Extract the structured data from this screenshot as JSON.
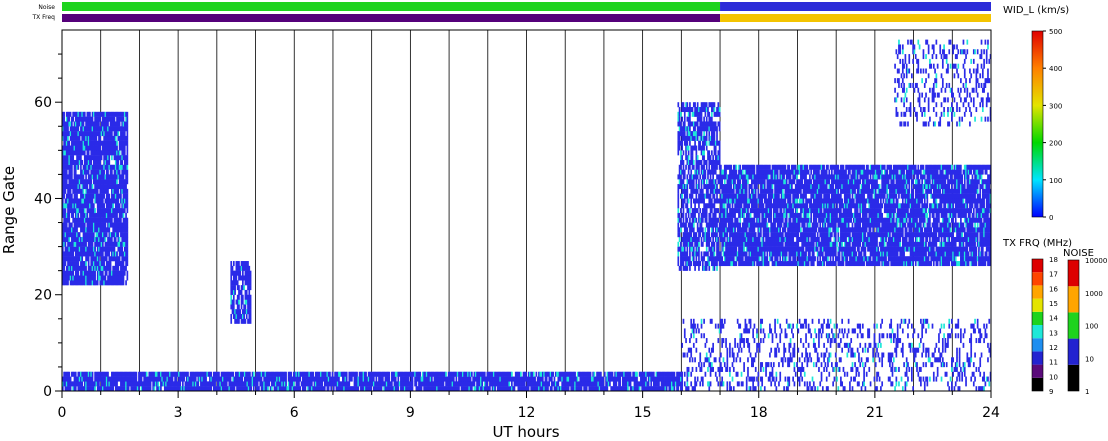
{
  "chart_data": {
    "type": "heatmap",
    "xlabel": "UT hours",
    "ylabel": "Range Gate",
    "xlim": [
      0,
      24
    ],
    "ylim": [
      0,
      75
    ],
    "x_ticks": [
      0,
      3,
      6,
      9,
      12,
      15,
      18,
      21,
      24
    ],
    "y_ticks": [
      0,
      20,
      40,
      60
    ],
    "hour_gridlines": true,
    "strip_labels": {
      "noise": "Noise",
      "freq": "TX Freq"
    },
    "strips": {
      "noise": [
        {
          "t0": 0,
          "t1": 17,
          "color": "#1ed31e"
        },
        {
          "t0": 17,
          "t1": 24,
          "color": "#2b2bd8"
        }
      ],
      "freq": [
        {
          "t0": 0,
          "t1": 17,
          "color": "#55007a"
        },
        {
          "t0": 17,
          "t1": 24,
          "color": "#f4c400"
        }
      ]
    },
    "echo_regions": [
      {
        "t0": 0.0,
        "t1": 1.7,
        "g0": 22,
        "g1": 58,
        "color": "#2a2ae8",
        "density": 0.9
      },
      {
        "t0": 4.35,
        "t1": 4.85,
        "g0": 14,
        "g1": 27,
        "color": "#2a2ae8",
        "density": 0.8
      },
      {
        "t0": 15.9,
        "t1": 17.0,
        "g0": 25,
        "g1": 60,
        "color": "#2a2ae8",
        "density": 0.7
      },
      {
        "t0": 17.0,
        "t1": 24.0,
        "g0": 26,
        "g1": 47,
        "color": "#2a2ae8",
        "density": 0.88
      },
      {
        "t0": 21.5,
        "t1": 24.0,
        "g0": 55,
        "g1": 73,
        "color": "#2a2ae8",
        "density": 0.25
      },
      {
        "t0": 0.0,
        "t1": 16.0,
        "g0": 0,
        "g1": 4,
        "color": "#2a2ae8",
        "density": 0.9
      },
      {
        "t0": 16.0,
        "t1": 24.0,
        "g0": 0,
        "g1": 15,
        "color": "#2a2ae8",
        "density": 0.25
      }
    ],
    "colorbars": [
      {
        "label": "WID_L (km/s)",
        "type": "continuous",
        "ticks": [
          "0",
          "100",
          "200",
          "300",
          "400",
          "500"
        ],
        "colors": [
          "#0000ff",
          "#00e5ff",
          "#00d800",
          "#e4e400",
          "#ff8000",
          "#e00000"
        ]
      },
      {
        "label": "TX FRQ (MHz)",
        "type": "discrete",
        "ticks": [
          "9",
          "10",
          "11",
          "12",
          "13",
          "14",
          "15",
          "16",
          "17",
          "18"
        ],
        "colors": [
          "#000000",
          "#5a0a7a",
          "#2323d0",
          "#1e8ef0",
          "#1ee8d8",
          "#1ed31e",
          "#e4e400",
          "#ffa500",
          "#ff4500",
          "#dd0000"
        ]
      },
      {
        "label": "NOISE",
        "type": "discrete",
        "ticks": [
          "1",
          "10",
          "100",
          "1000",
          "10000"
        ],
        "colors": [
          "#000000",
          "#2323d0",
          "#1ed31e",
          "#ffa500",
          "#dd0000"
        ]
      }
    ]
  }
}
